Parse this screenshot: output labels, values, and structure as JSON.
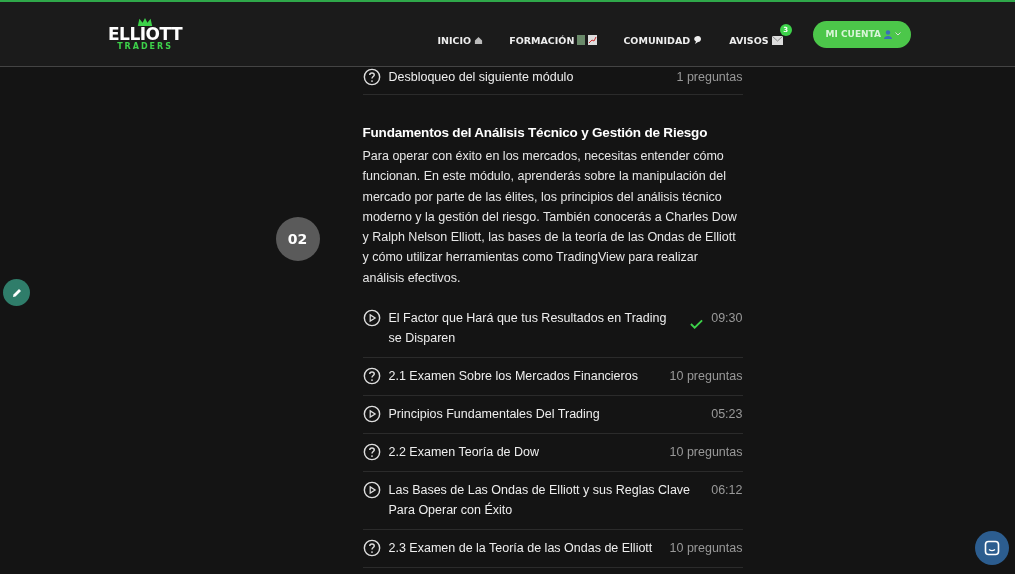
{
  "header": {
    "logo": {
      "title": "ELLIOTT",
      "subtitle": "TRADERS"
    },
    "nav": [
      {
        "label": "INICIO",
        "kind": "home"
      },
      {
        "label": "FORMACIÓN",
        "kind": "courses"
      },
      {
        "label": "COMUNIDAD",
        "kind": "community"
      },
      {
        "label": "AVISOS",
        "kind": "notices",
        "badge": "3"
      }
    ],
    "account_button": "MI CUENTA"
  },
  "previous_lessons": [
    {
      "kind": "quiz",
      "title": "Desbloqueo del siguiente módulo",
      "meta": "1 preguntas",
      "completed": false
    }
  ],
  "module": {
    "number": "02",
    "title": "Fundamentos del Análisis Técnico y Gestión de Riesgo",
    "description": "Para operar con éxito en los mercados, necesitas entender cómo funcionan. En este módulo, aprenderás sobre la manipulación del mercado por parte de las élites, los principios del análisis técnico moderno y la gestión del riesgo. También conocerás a Charles Dow y Ralph Nelson Elliott, las bases de la teoría de las Ondas de Elliott y cómo utilizar herramientas como TradingView para realizar análisis efectivos.",
    "lessons": [
      {
        "kind": "video",
        "title": "El Factor que Hará que tus Resultados en Trading se Disparen",
        "meta": "09:30",
        "completed": true
      },
      {
        "kind": "quiz",
        "title": "2.1 Examen Sobre los Mercados Financieros",
        "meta": "10 preguntas",
        "completed": false
      },
      {
        "kind": "video",
        "title": "Principios Fundamentales Del Trading",
        "meta": "05:23",
        "completed": false
      },
      {
        "kind": "quiz",
        "title": "2.2 Examen Teoría de Dow",
        "meta": "10 preguntas",
        "completed": false
      },
      {
        "kind": "video",
        "title": "Las Bases de Las Ondas de Elliott y sus Reglas Clave Para Operar con Éxito",
        "meta": "06:12",
        "completed": false
      },
      {
        "kind": "quiz",
        "title": "2.3 Examen de la Teoría de las Ondas de Elliott",
        "meta": "10 preguntas",
        "completed": false
      }
    ]
  }
}
